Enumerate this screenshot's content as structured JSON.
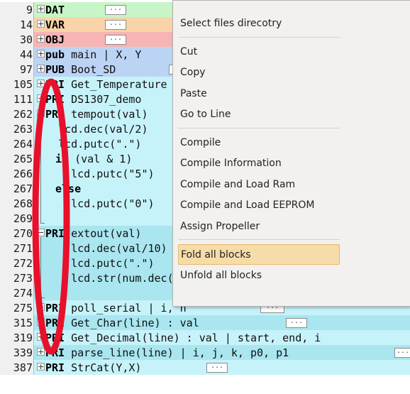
{
  "editor": {
    "lines": [
      {
        "num": "9",
        "fold": "⊞",
        "kw": "DAT",
        "text": "",
        "bg": "#c8f5c8",
        "dots": true
      },
      {
        "num": "14",
        "fold": "⊞",
        "kw": "VAR",
        "text": "",
        "bg": "#f9d4a8",
        "dots": true
      },
      {
        "num": "30",
        "fold": "⊞",
        "kw": "OBJ",
        "text": "",
        "bg": "#f7b4b4",
        "dots": true
      },
      {
        "num": "44",
        "fold": "⊞",
        "kw": "pub",
        "text": " main | X, Y",
        "bg": "#bcd4f4",
        "dots": false
      },
      {
        "num": "97",
        "fold": "⊞",
        "kw": "PUB",
        "text": " Boot_SD",
        "bg": "#bcd4f4",
        "dots": true
      },
      {
        "num": "105",
        "fold": "⊞",
        "kw": "PRI",
        "text": " Get_Temperature",
        "bg": "#c6f3fa",
        "dots": false
      },
      {
        "num": "111",
        "fold": "⊞",
        "kw": "PRI",
        "text": " DS1307_demo",
        "bg": "#c6f3fa",
        "dots": true
      },
      {
        "num": "262",
        "fold": "⊟",
        "kw": "PRI",
        "text": " tempout(val)",
        "bg": "#c6f3fa",
        "dots": false
      },
      {
        "num": "263",
        "fold": "",
        "kw": "",
        "text": "  lcd.dec(val/2)",
        "bg": "#c6f3fa",
        "dots": false
      },
      {
        "num": "264",
        "fold": "",
        "kw": "",
        "text": "  lcd.putc(\".\")",
        "bg": "#c6f3fa",
        "dots": false
      },
      {
        "num": "265",
        "fold": "",
        "kw": "if",
        "text": " (val & 1)",
        "bg": "#c6f3fa",
        "dots": false
      },
      {
        "num": "266",
        "fold": "",
        "kw": "",
        "text": "    lcd.putc(\"5\")",
        "bg": "#c6f3fa",
        "dots": false
      },
      {
        "num": "267",
        "fold": "",
        "kw": "else",
        "text": "",
        "bg": "#c6f3fa",
        "dots": false
      },
      {
        "num": "268",
        "fold": "",
        "kw": "",
        "text": "    lcd.putc(\"0\")",
        "bg": "#c6f3fa",
        "dots": false
      },
      {
        "num": "269",
        "fold": "",
        "kw": "",
        "text": "",
        "bg": "#c6f3fa",
        "dots": false
      },
      {
        "num": "270",
        "fold": "⊟",
        "kw": "PRI",
        "text": " extout(val)",
        "bg": "#a9e6ef",
        "dots": false
      },
      {
        "num": "271",
        "fold": "",
        "kw": "",
        "text": "    lcd.dec(val/10)",
        "bg": "#a9e6ef",
        "dots": false
      },
      {
        "num": "272",
        "fold": "",
        "kw": "",
        "text": "    lcd.putc(\".\")",
        "bg": "#a9e6ef",
        "dots": false
      },
      {
        "num": "273",
        "fold": "",
        "kw": "",
        "text": "    lcd.str(num.dec(val))",
        "bg": "#a9e6ef",
        "dots": false
      },
      {
        "num": "274",
        "fold": "",
        "kw": "",
        "text": "",
        "bg": "#a9e6ef",
        "dots": false
      },
      {
        "num": "275",
        "fold": "⊞",
        "kw": "PRI",
        "text": " poll_serial | i, h",
        "bg": "#c6f3fa",
        "dots": true
      },
      {
        "num": "315",
        "fold": "⊞",
        "kw": "PRI",
        "text": " Get_Char(line) : val",
        "bg": "#a9e6ef",
        "dots": true
      },
      {
        "num": "319",
        "fold": "⊞",
        "kw": "PRI",
        "text": " Get_Decimal(line) : val | start, end, i",
        "bg": "#c6f3fa",
        "dots": false
      },
      {
        "num": "339",
        "fold": "⊞",
        "kw": "PRI",
        "text": " parse_line(line) | i, j, k, p0, p1",
        "bg": "#a9e6ef",
        "dots": true
      },
      {
        "num": "387",
        "fold": "⊞",
        "kw": "PRI",
        "text": " StrCat(Y,X)",
        "bg": "#c6f3fa",
        "dots": true
      }
    ],
    "dots_label": "..."
  },
  "menu": {
    "items": [
      {
        "label": "Select files direcotry",
        "sep_after": true,
        "highlighted": false
      },
      {
        "label": "Cut",
        "sep_after": false,
        "highlighted": false
      },
      {
        "label": "Copy",
        "sep_after": false,
        "highlighted": false
      },
      {
        "label": "Paste",
        "sep_after": false,
        "highlighted": false
      },
      {
        "label": "Go to Line",
        "sep_after": true,
        "highlighted": false
      },
      {
        "label": "Compile",
        "sep_after": false,
        "highlighted": false
      },
      {
        "label": "Compile Information",
        "sep_after": false,
        "highlighted": false
      },
      {
        "label": "Compile and Load Ram",
        "sep_after": false,
        "highlighted": false
      },
      {
        "label": "Compile and Load EEPROM",
        "sep_after": false,
        "highlighted": false
      },
      {
        "label": "Assign Propeller",
        "sep_after": true,
        "highlighted": false
      },
      {
        "label": "Fold all blocks",
        "sep_after": false,
        "highlighted": true
      },
      {
        "label": "Unfold all blocks",
        "sep_after": false,
        "highlighted": false
      }
    ]
  },
  "annotation": {
    "color": "#e8102a"
  }
}
